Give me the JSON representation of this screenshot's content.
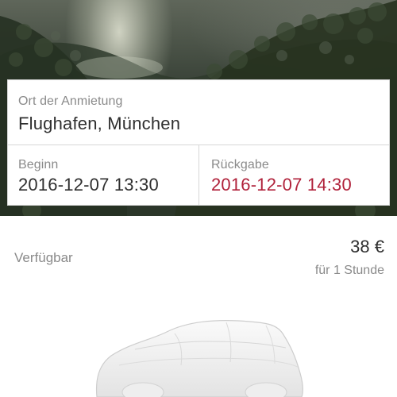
{
  "booking": {
    "pickup_location_label": "Ort der Anmietung",
    "pickup_location_value": "Flughafen, München",
    "start_label": "Beginn",
    "start_value": "2016-12-07 13:30",
    "return_label": "Rückgabe",
    "return_value": "2016-12-07 14:30"
  },
  "offer": {
    "availability": "Verfügbar",
    "price": "38 €",
    "price_unit": "für 1 Stunde"
  },
  "colors": {
    "accent_red": "#b0213a",
    "label_gray": "#8a8a8a",
    "text_dark": "#2f2f2f"
  },
  "images": {
    "hero": "forest-landscape-photo",
    "vehicle": "covered-car-silhouette"
  }
}
